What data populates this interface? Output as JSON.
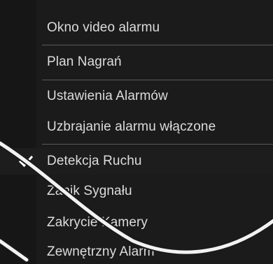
{
  "menu": {
    "items": [
      {
        "label": "Okno video alarmu",
        "checked": false
      },
      {
        "label": "Plan Nagrań",
        "checked": false
      },
      {
        "label": "Ustawienia Alarmów",
        "checked": false
      },
      {
        "label": "Uzbrajanie alarmu włączone",
        "checked": false
      },
      {
        "label": "Detekcja Ruchu",
        "checked": true
      },
      {
        "label": "Zanik Sygnału",
        "checked": false
      },
      {
        "label": "Zakrycie Kamery",
        "checked": false
      },
      {
        "label": "Zewnętrzny Alarm",
        "checked": false
      }
    ]
  },
  "colors": {
    "menu_background": "#1b1b1b",
    "text": "#dcdcdc",
    "separator": "#5a5a5a",
    "checkmark": "#ffffff",
    "overlay_arc": "#f2f2f2"
  },
  "icons": {
    "check": "checkmark-icon"
  }
}
